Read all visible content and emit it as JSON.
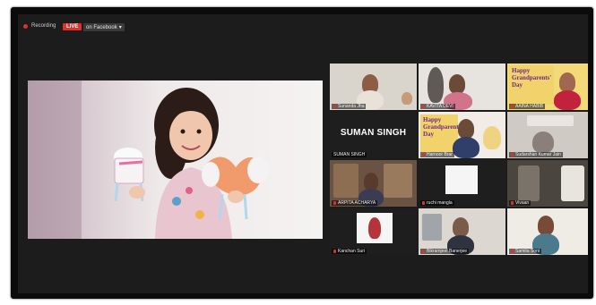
{
  "meeting": {
    "recording_label": "Recording",
    "live_label": "LIVE",
    "live_destination": "on Facebook",
    "colors": {
      "live": "#e0302b",
      "background": "#1c1c1c",
      "card": "#f2d26a"
    }
  },
  "participants": [
    {
      "name": "Sunanda Jha"
    },
    {
      "name": "KAVITA DEVI"
    },
    {
      "name": "AAINA HABIB"
    },
    {
      "name": "SUMAN SINGH",
      "display_text": "SUMAN SINGH"
    },
    {
      "name": "Harnoor Brar"
    },
    {
      "name": "Sudarshan Kumar Jain"
    },
    {
      "name": "ARPITA ACHARYA"
    },
    {
      "name": "ruchi mangla"
    },
    {
      "name": "Vivaan"
    },
    {
      "name": "Kanchan Suri"
    },
    {
      "name": "Bikramjeet Banerjee"
    },
    {
      "name": "Samita Soni"
    }
  ],
  "cards": {
    "grandparents_1": "Happy Grandparents' Day",
    "grandparents_2": "Happy Grandparents' Day"
  }
}
